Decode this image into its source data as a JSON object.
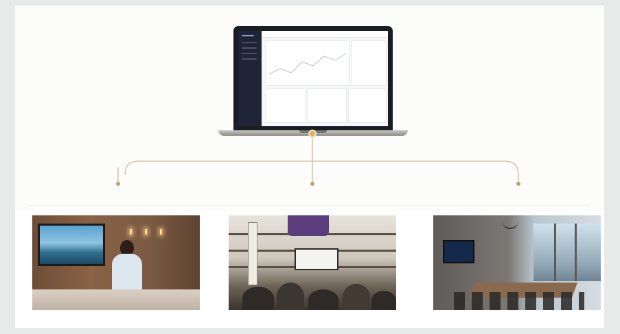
{
  "diagram": {
    "hub": {
      "device": "laptop"
    },
    "nodes": [
      {
        "id": "lobby",
        "label": ""
      },
      {
        "id": "restaurant",
        "label": ""
      },
      {
        "id": "conference",
        "label": ""
      }
    ],
    "colors": {
      "connector": "#d4c5a8",
      "hub_dot": "#d8b46a",
      "background": "#e8e9e9",
      "card": "#ffffff"
    },
    "icons": {
      "hub": "laptop-icon",
      "node_marker": "pin-icon"
    }
  }
}
